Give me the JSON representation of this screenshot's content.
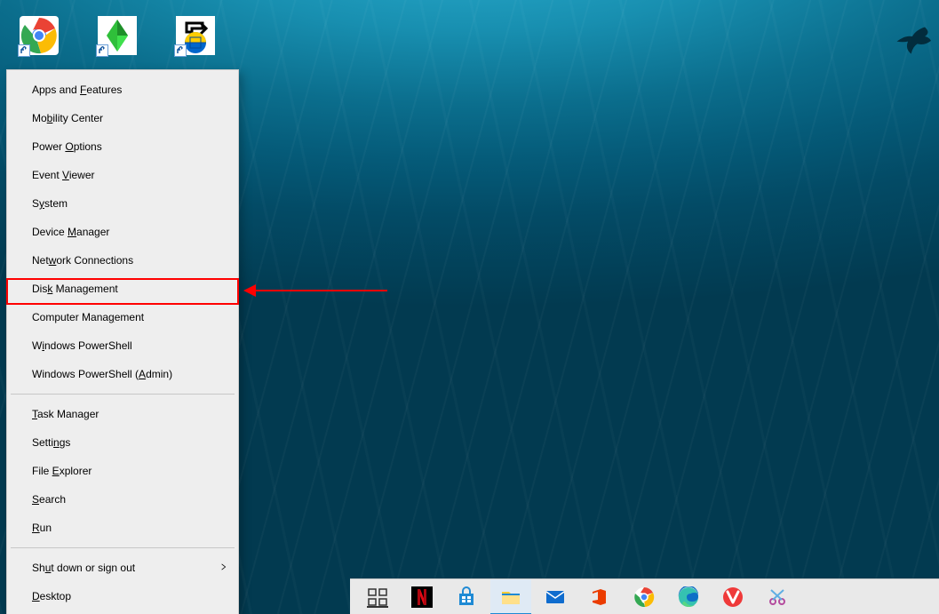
{
  "desktop_icons": [
    {
      "name": "chrome-shortcut",
      "label": ""
    },
    {
      "name": "sims-shortcut",
      "label": ""
    },
    {
      "name": "stellar-shortcut",
      "label": ""
    }
  ],
  "menu": {
    "group1": [
      {
        "id": "apps-features",
        "pre": "Apps and ",
        "u": "F",
        "post": "eatures"
      },
      {
        "id": "mobility-center",
        "pre": "Mo",
        "u": "b",
        "post": "ility Center"
      },
      {
        "id": "power-options",
        "pre": "Power ",
        "u": "O",
        "post": "ptions"
      },
      {
        "id": "event-viewer",
        "pre": "Event ",
        "u": "V",
        "post": "iewer"
      },
      {
        "id": "system",
        "pre": "S",
        "u": "y",
        "post": "stem"
      },
      {
        "id": "device-manager",
        "pre": "Device ",
        "u": "M",
        "post": "anager"
      },
      {
        "id": "network-connections",
        "pre": "Net",
        "u": "w",
        "post": "ork Connections"
      },
      {
        "id": "disk-management",
        "pre": "Dis",
        "u": "k",
        "post": " Management"
      },
      {
        "id": "computer-management",
        "pre": "Computer Mana",
        "u": "g",
        "post": "ement"
      },
      {
        "id": "powershell",
        "pre": "W",
        "u": "i",
        "post": "ndows PowerShell"
      },
      {
        "id": "powershell-admin",
        "pre": "Windows PowerShell (",
        "u": "A",
        "post": "dmin)"
      }
    ],
    "group2": [
      {
        "id": "task-manager",
        "pre": "",
        "u": "T",
        "post": "ask Manager"
      },
      {
        "id": "settings",
        "pre": "Setti",
        "u": "n",
        "post": "gs"
      },
      {
        "id": "file-explorer",
        "pre": "File ",
        "u": "E",
        "post": "xplorer"
      },
      {
        "id": "search",
        "pre": "",
        "u": "S",
        "post": "earch"
      },
      {
        "id": "run",
        "pre": "",
        "u": "R",
        "post": "un"
      }
    ],
    "group3": [
      {
        "id": "shutdown-signout",
        "pre": "Sh",
        "u": "u",
        "post": "t down or sign out",
        "submenu": true
      },
      {
        "id": "desktop",
        "pre": "",
        "u": "D",
        "post": "esktop"
      }
    ]
  },
  "taskbar": [
    {
      "id": "task-view",
      "kind": "taskview"
    },
    {
      "id": "netflix",
      "kind": "netflix"
    },
    {
      "id": "ms-store",
      "kind": "store"
    },
    {
      "id": "file-explorer",
      "kind": "explorer",
      "active": true
    },
    {
      "id": "mail",
      "kind": "mail"
    },
    {
      "id": "office",
      "kind": "office"
    },
    {
      "id": "chrome",
      "kind": "chrome"
    },
    {
      "id": "edge",
      "kind": "edge"
    },
    {
      "id": "vivaldi",
      "kind": "vivaldi"
    },
    {
      "id": "snip",
      "kind": "snip"
    }
  ]
}
